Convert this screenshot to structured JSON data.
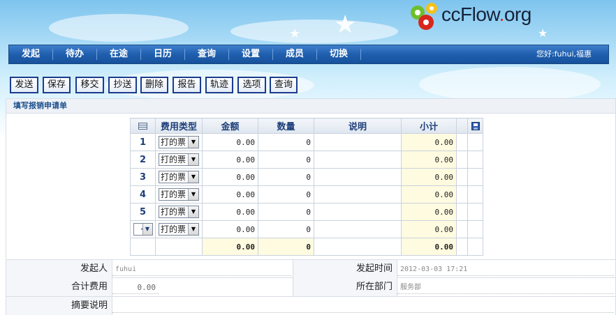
{
  "logo": {
    "text_main": "ccFlow",
    "text_dot": ".",
    "text_tail": "org"
  },
  "nav": {
    "items": [
      "发起",
      "待办",
      "在途",
      "日历",
      "查询",
      "设置",
      "成员",
      "切换"
    ],
    "greeting": "您好:fuhui,福惠"
  },
  "toolbar": {
    "buttons": [
      "发送",
      "保存",
      "移交",
      "抄送",
      "删除",
      "报告",
      "轨迹",
      "选项",
      "查询"
    ]
  },
  "form": {
    "title": "填写报销申请单",
    "table": {
      "headers": [
        "费用类型",
        "金额",
        "数量",
        "说明",
        "小计"
      ],
      "rows": [
        {
          "index": "1",
          "type": "打的票",
          "amount": "0.00",
          "qty": "0",
          "note": "",
          "subtotal": "0.00"
        },
        {
          "index": "2",
          "type": "打的票",
          "amount": "0.00",
          "qty": "0",
          "note": "",
          "subtotal": "0.00"
        },
        {
          "index": "3",
          "type": "打的票",
          "amount": "0.00",
          "qty": "0",
          "note": "",
          "subtotal": "0.00"
        },
        {
          "index": "4",
          "type": "打的票",
          "amount": "0.00",
          "qty": "0",
          "note": "",
          "subtotal": "0.00"
        },
        {
          "index": "5",
          "type": "打的票",
          "amount": "0.00",
          "qty": "0",
          "note": "",
          "subtotal": "0.00"
        },
        {
          "index": "+",
          "type": "打的票",
          "amount": "0.00",
          "qty": "0",
          "note": "",
          "subtotal": "0.00"
        }
      ],
      "total": {
        "amount": "0.00",
        "qty": "0",
        "subtotal": "0.00"
      }
    },
    "fields": {
      "initiator_label": "发起人",
      "initiator_value": "fuhui",
      "start_time_label": "发起时间",
      "start_time_value": "2012-03-03 17:21",
      "total_cost_label": "合计费用",
      "total_cost_value": "0.00",
      "dept_label": "所在部门",
      "dept_value": "服务部",
      "summary_label": "摘要说明",
      "summary_value": ""
    }
  }
}
